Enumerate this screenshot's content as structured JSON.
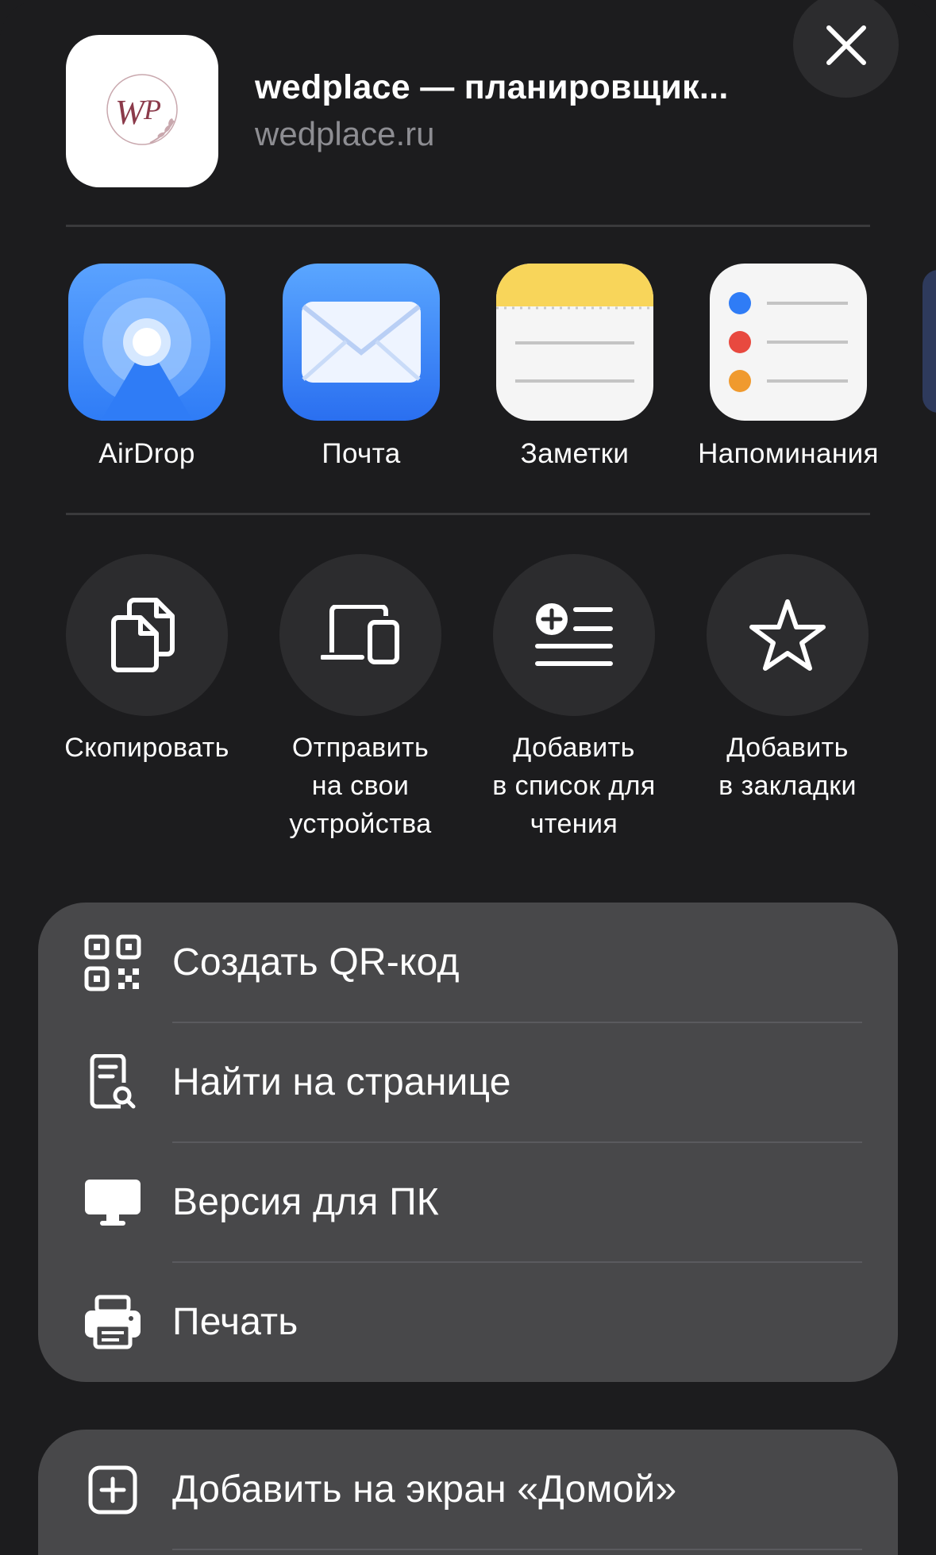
{
  "header": {
    "title": "wedplace — планировщик...",
    "subtitle": "wedplace.ru",
    "logo_text": "WP"
  },
  "apps": [
    {
      "label": "AirDrop",
      "icon": "airdrop-icon"
    },
    {
      "label": "Почта",
      "icon": "mail-icon"
    },
    {
      "label": "Заметки",
      "icon": "notes-icon"
    },
    {
      "label": "Напоминания",
      "icon": "reminders-icon"
    }
  ],
  "actions": [
    {
      "line1": "Скопировать",
      "line2": "",
      "line3": "",
      "icon": "copy-icon"
    },
    {
      "line1": "Отправить",
      "line2": "на свои",
      "line3": "устройства",
      "icon": "devices-icon"
    },
    {
      "line1": "Добавить",
      "line2": "в список для",
      "line3": "чтения",
      "icon": "reading-list-icon"
    },
    {
      "line1": "Добавить",
      "line2": "в закладки",
      "line3": "",
      "icon": "star-icon"
    }
  ],
  "list_group_1": [
    {
      "label": "Создать QR-код",
      "icon": "qr-code-icon"
    },
    {
      "label": "Найти на странице",
      "icon": "find-on-page-icon"
    },
    {
      "label": "Версия для ПК",
      "icon": "desktop-icon"
    },
    {
      "label": "Печать",
      "icon": "printer-icon"
    }
  ],
  "list_group_2": [
    {
      "label": "Добавить на экран «Домой»",
      "icon": "add-square-icon"
    }
  ],
  "colors": {
    "background": "#1c1c1e",
    "circle": "#2c2c2e",
    "group": "#48484a",
    "airdrop_blue": "#2f7cf6",
    "mail_blue": "#3a7ff0",
    "notes_yellow": "#f8d55a",
    "logo_maroon": "#8b3a4a"
  }
}
